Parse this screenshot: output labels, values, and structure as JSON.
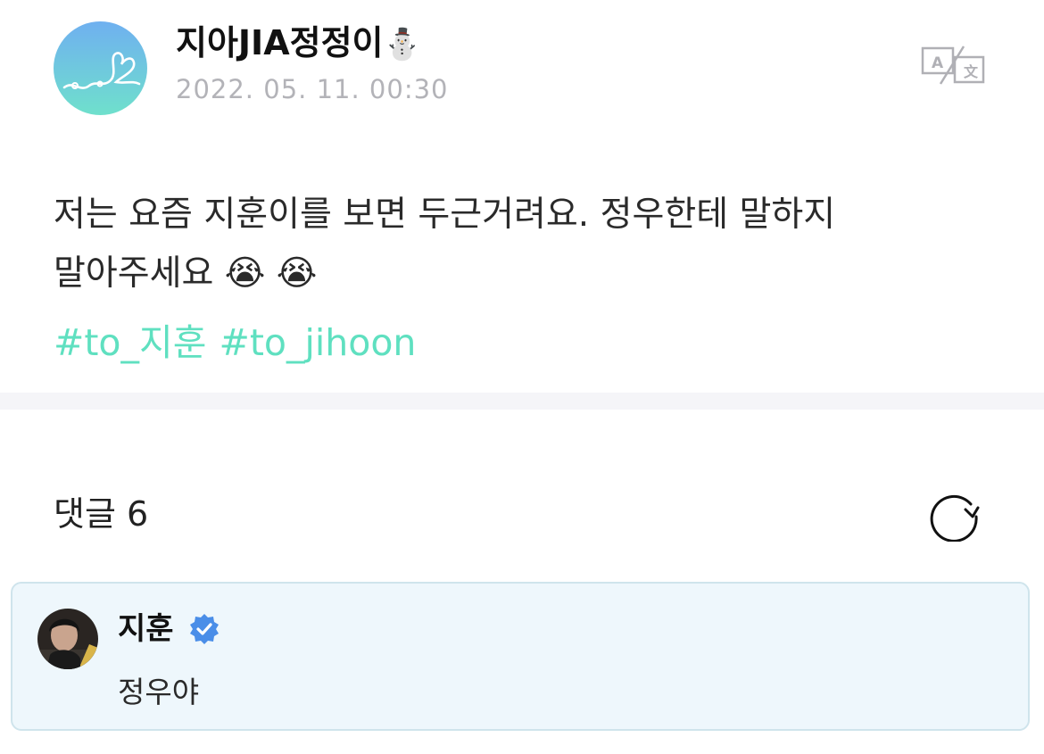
{
  "post": {
    "author_name": "지아JIA정정이",
    "author_emoji": "⛄",
    "date": "2022. 05. 11. 00:30",
    "translate_icon": "translate-icon",
    "body_line1": "저는 요즘 지훈이를 보면 두근거려요. 정우한테 말하지",
    "body_line2": "말아주세요 😭 😭",
    "hashtags": [
      "#to_지훈",
      "#to_jihoon"
    ]
  },
  "comments": {
    "title": "댓글 6",
    "refresh_icon": "refresh-icon",
    "items": [
      {
        "author": "지훈",
        "verified": true,
        "text": "정우야"
      }
    ]
  },
  "colors": {
    "accent": "#5fe0c0",
    "date_gray": "#b3b3b8",
    "comment_bg": "#eef7fc",
    "comment_border": "#cfe4ec",
    "verified_blue": "#4a8ee8"
  }
}
